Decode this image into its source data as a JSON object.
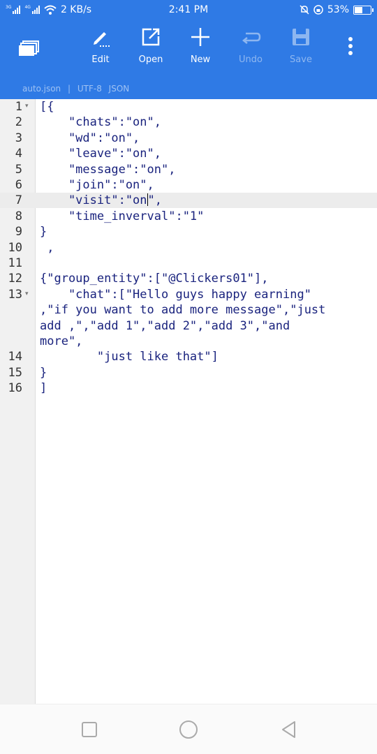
{
  "status_bar": {
    "net_speed": "2 KB/s",
    "time": "2:41 PM",
    "battery": "53%",
    "battery_level": 0.53,
    "sim1_label": "3G",
    "sim2_label": "4G"
  },
  "toolbar": {
    "edit_label": "Edit",
    "open_label": "Open",
    "new_label": "New",
    "undo_label": "Undo",
    "save_label": "Save"
  },
  "file_info": {
    "filename": "auto.json",
    "separator": "|",
    "encoding": "UTF-8",
    "syntax": "JSON"
  },
  "editor": {
    "current_line": 7,
    "lines": [
      {
        "n": "1",
        "fold": true,
        "text": "[{"
      },
      {
        "n": "2",
        "text": "    \"chats\":\"on\","
      },
      {
        "n": "3",
        "text": "    \"wd\":\"on\","
      },
      {
        "n": "4",
        "text": "    \"leave\":\"on\","
      },
      {
        "n": "5",
        "text": "    \"message\":\"on\","
      },
      {
        "n": "6",
        "text": "    \"join\":\"on\","
      },
      {
        "n": "7",
        "text": "    \"visit\":\"on\",",
        "cursor_after": "    \"visit\":\"on"
      },
      {
        "n": "8",
        "text": "    \"time_inverval\":\"1\""
      },
      {
        "n": "9",
        "text": "}"
      },
      {
        "n": "10",
        "text": " ,"
      },
      {
        "n": "11",
        "text": ""
      },
      {
        "n": "12",
        "text": "{\"group_entity\":[\"@Clickers01\"],"
      },
      {
        "n": "13",
        "fold": true,
        "text": "    \"chat\":[\"Hello guys happy earning\""
      },
      {
        "n": "",
        "text": ",\"if you want to add more message\",\"just"
      },
      {
        "n": "",
        "text": "add ,\",\"add 1\",\"add 2\",\"add 3\",\"and"
      },
      {
        "n": "",
        "text": "more\","
      },
      {
        "n": "14",
        "text": "        \"just like that\"]"
      },
      {
        "n": "15",
        "text": "}"
      },
      {
        "n": "16",
        "text": "]"
      }
    ]
  },
  "colors": {
    "primary": "#2f7ae5",
    "code_text": "#1a237e",
    "gutter": "#f1f1f1"
  },
  "icons": {
    "nav": "tabs-stack-icon",
    "edit": "pencil-icon",
    "open": "external-link-icon",
    "new": "plus-icon",
    "undo": "undo-arrow-icon",
    "save": "floppy-disk-icon",
    "more": "more-vert-icon"
  }
}
